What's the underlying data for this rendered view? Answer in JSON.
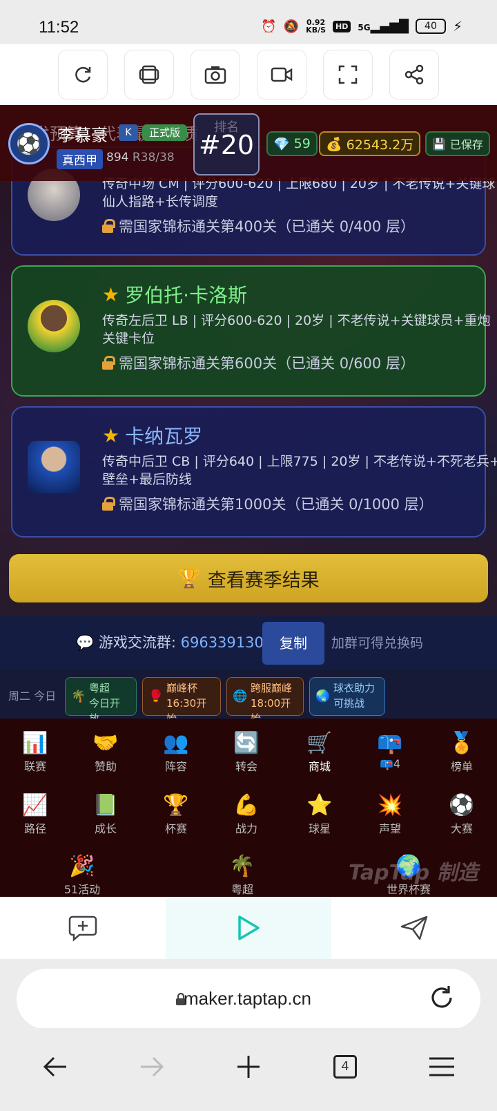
{
  "status_bar": {
    "time": "11:52",
    "net_speed_top": "0.92",
    "net_speed_unit": "KB/S",
    "hd": "HD",
    "signal": "5G",
    "battery": "40"
  },
  "toolbar": {
    "icons": [
      "refresh-icon",
      "layers-icon",
      "camera-icon",
      "video-icon",
      "fullscreen-icon",
      "share-icon"
    ]
  },
  "header": {
    "ghost_text": "开发预算：代表最终品质",
    "player_name": "李慕豪",
    "badge_small": "K",
    "badge_tag": "正式版",
    "league": "真西甲",
    "points": "894",
    "round": "R38/38",
    "rank_label": "排名",
    "rank": "#20",
    "gems": "59",
    "money": "62543.2万",
    "saved": "已保存"
  },
  "cards": [
    {
      "name": "",
      "desc": "传奇中场 CM | 评分600-620 | 上限680 | 20岁 | 不老传说+关键球",
      "desc2": "仙人指路+长传调度",
      "lock": "需国家锦标通关第400关（已通关 0/400 层）"
    },
    {
      "name": "罗伯托·卡洛斯",
      "desc": "传奇左后卫 LB | 评分600-620 | 20岁 | 不老传说+关键球员+重炮",
      "desc2": "关键卡位",
      "lock": "需国家锦标通关第600关（已通关 0/600 层）"
    },
    {
      "name": "卡纳瓦罗",
      "desc": "传奇中后卫 CB | 评分640 | 上限775 | 20岁 | 不老传说+不死老兵+",
      "desc2": "壁垒+最后防线",
      "lock": "需国家锦标通关第1000关（已通关 0/1000 层）"
    }
  ],
  "season_button": "查看赛季结果",
  "group": {
    "label": "游戏交流群:",
    "number": "696339130",
    "copy": "复制",
    "hint": "加群可得兑换码"
  },
  "events": {
    "day": "周二 今日",
    "items": [
      {
        "title": "粤超",
        "sub": "今日开放"
      },
      {
        "title": "巅峰杯",
        "sub": "16:30开始"
      },
      {
        "title": "跨服巅峰",
        "sub": "18:00开始"
      },
      {
        "title": "球衣助力",
        "sub": "可挑战"
      }
    ]
  },
  "menu": {
    "row1": [
      "联赛",
      "赞助",
      "阵容",
      "转会",
      "商城",
      "📪4",
      "榜单"
    ],
    "row2": [
      "路径",
      "成长",
      "杯赛",
      "战力",
      "球星",
      "声望",
      "大赛"
    ],
    "row3": [
      "51活动",
      "粤超",
      "世界杯赛"
    ],
    "watermark": "TapTap 制造"
  },
  "url": {
    "text": "maker.taptap.cn"
  },
  "nav": {
    "tabs": "4"
  }
}
